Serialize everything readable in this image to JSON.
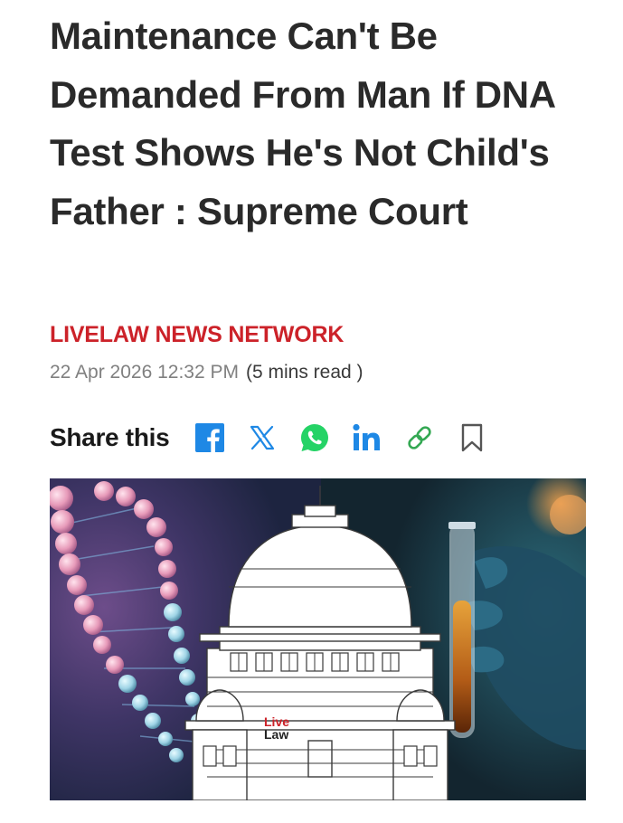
{
  "article": {
    "headline": "Maintenance Can't Be Demanded From Man If DNA Test Shows He's Not Child's Father : Supreme Court",
    "author": "LIVELAW NEWS NETWORK",
    "timestamp": "22 Apr 2026 12:32 PM",
    "read_time": "(5 mins read )"
  },
  "share": {
    "label": "Share this",
    "icons": [
      "facebook-icon",
      "x-icon",
      "whatsapp-icon",
      "linkedin-icon",
      "link-icon",
      "bookmark-icon"
    ]
  },
  "hero_image": {
    "watermark_line1": "Live",
    "watermark_line2": "Law"
  },
  "colors": {
    "author": "#cc2229",
    "share_icon": "#1e88e5",
    "whatsapp": "#25d366",
    "bookmark": "#555555"
  }
}
